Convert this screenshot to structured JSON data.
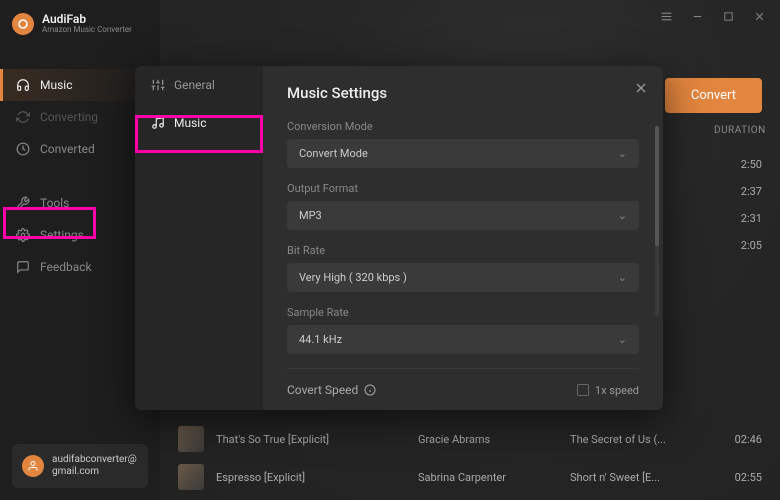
{
  "brand": {
    "title": "AudiFab",
    "subtitle": "Amazon Music Converter"
  },
  "nav": {
    "music": "Music",
    "converting": "Converting",
    "converted": "Converted",
    "tools": "Tools",
    "settings": "Settings",
    "feedback": "Feedback"
  },
  "user": {
    "email": "audifabconverter@gmail.com"
  },
  "main": {
    "convert_label": "Convert",
    "col_duration": "DURATION"
  },
  "durations": [
    "2:50",
    "2:37",
    "2:31",
    "2:05"
  ],
  "tracks": [
    {
      "title": "That's So True [Explicit]",
      "artist": "Gracie Abrams",
      "album": "The Secret of Us (...",
      "dur": "02:46"
    },
    {
      "title": "Espresso [Explicit]",
      "artist": "Sabrina Carpenter",
      "album": "Short n' Sweet [E...",
      "dur": "02:55"
    }
  ],
  "modal": {
    "tab_general": "General",
    "tab_music": "Music",
    "title": "Music Settings",
    "fields": {
      "conversion_mode": {
        "label": "Conversion Mode",
        "value": "Convert Mode"
      },
      "output_format": {
        "label": "Output Format",
        "value": "MP3"
      },
      "bit_rate": {
        "label": "Bit Rate",
        "value": "Very High ( 320 kbps )"
      },
      "sample_rate": {
        "label": "Sample Rate",
        "value": "44.1 kHz"
      }
    },
    "speed": {
      "label": "Covert Speed",
      "checkbox": "1x speed"
    }
  }
}
